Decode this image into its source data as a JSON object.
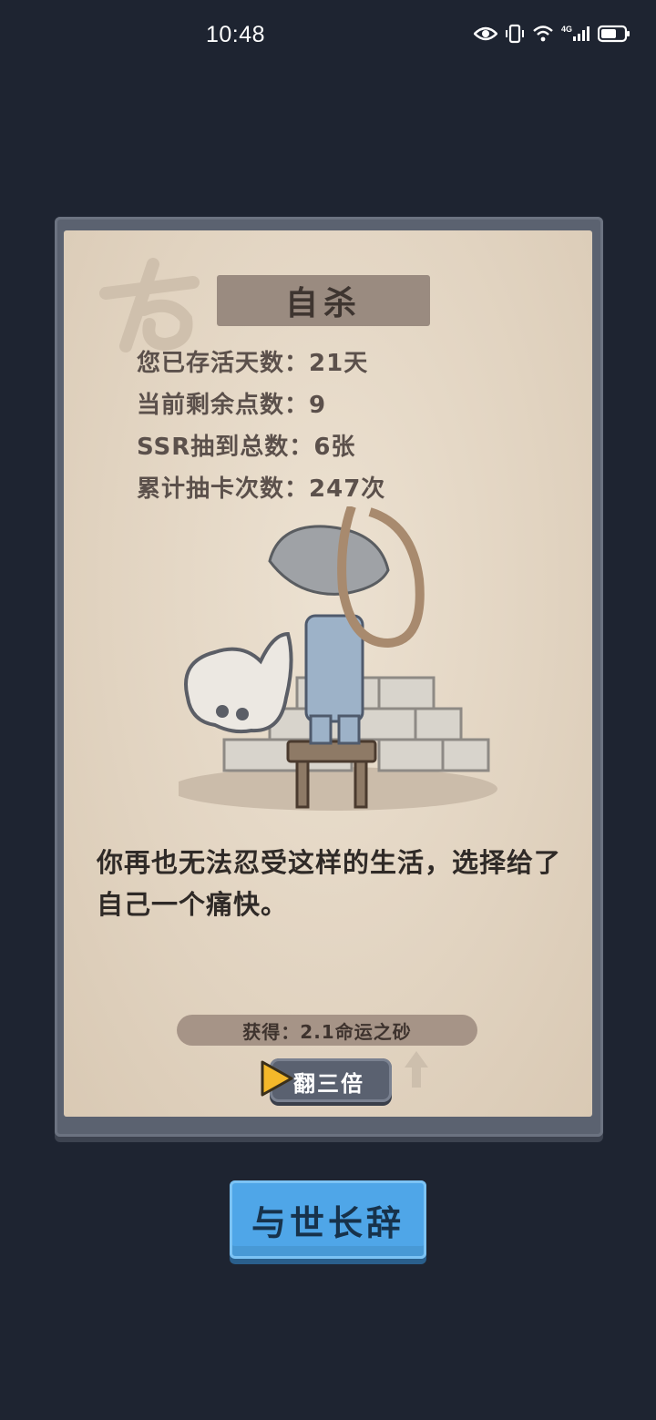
{
  "status_bar": {
    "time": "10:48",
    "network": "4G"
  },
  "event": {
    "title": "自杀",
    "stats": [
      {
        "label": "您已存活天数：",
        "value": "21天"
      },
      {
        "label": "当前剩余点数：",
        "value": "9"
      },
      {
        "label": "SSR抽到总数：",
        "value": "6张"
      },
      {
        "label": "累计抽卡次数：",
        "value": "247次"
      }
    ],
    "description": "你再也无法忍受这样的生活，选择给了自己一个痛快。",
    "reward": "获得：2.1命运之砂",
    "triple_button": "翻三倍"
  },
  "farewell_button": "与世长辞",
  "colors": {
    "background": "#1e2431",
    "card": "#e3d6c4",
    "frame": "#5b6270",
    "accent_blue": "#4fa6e8",
    "play_gold": "#f4b82a"
  }
}
